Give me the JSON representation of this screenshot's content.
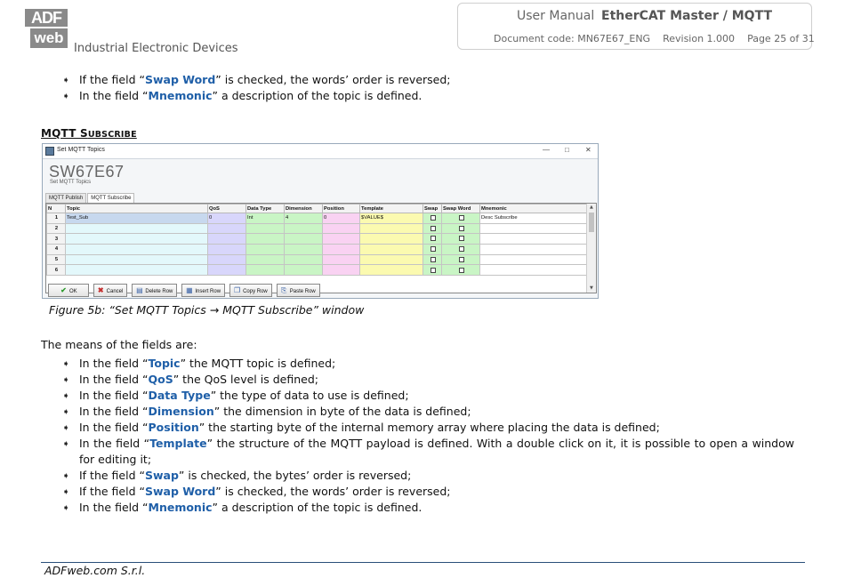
{
  "header": {
    "logo_top": "ADF",
    "logo_bottom": "web",
    "company": "Industrial Electronic Devices",
    "manual": "User Manual",
    "product": "EtherCAT Master / MQTT",
    "doc_code": "Document code: MN67E67_ENG",
    "revision": "Revision 1.000",
    "page": "Page 25 of 31"
  },
  "bullet_icon": "arrow-bullet-icon",
  "top_list": [
    {
      "pre": "If the field “",
      "term": "Swap Word",
      "post": "” is checked, the words’ order is reversed;"
    },
    {
      "pre": "In the field “",
      "term": "Mnemonic",
      "post": "” a description of the topic is defined."
    }
  ],
  "section_title": {
    "first": "MQTT S",
    "rest": "UBSCRIBE"
  },
  "window": {
    "title": "Set MQTT Topics",
    "controls": [
      "—",
      "□",
      "✕"
    ],
    "app_title": "SW67E67",
    "app_subtitle": "Set MQTT Topics",
    "tabs": [
      "MQTT Publish",
      "MQTT Subscribe"
    ],
    "active_tab": 1,
    "columns": [
      "N",
      "Topic",
      "QoS",
      "Data Type",
      "Dimension",
      "Position",
      "Template",
      "Swap",
      "Swap Word",
      "Mnemonic"
    ],
    "rows": [
      {
        "n": "1",
        "topic": "Test_Sub",
        "qos": "0",
        "data_type": "Int",
        "dimension": "4",
        "position": "0",
        "template": "$VALUE$",
        "swap": false,
        "swap_word": false,
        "mnemonic": "Desc Subscribe"
      },
      {
        "n": "2",
        "topic": "",
        "qos": "",
        "data_type": "",
        "dimension": "",
        "position": "",
        "template": "",
        "swap": false,
        "swap_word": false,
        "mnemonic": ""
      },
      {
        "n": "3",
        "topic": "",
        "qos": "",
        "data_type": "",
        "dimension": "",
        "position": "",
        "template": "",
        "swap": false,
        "swap_word": false,
        "mnemonic": ""
      },
      {
        "n": "4",
        "topic": "",
        "qos": "",
        "data_type": "",
        "dimension": "",
        "position": "",
        "template": "",
        "swap": false,
        "swap_word": false,
        "mnemonic": ""
      },
      {
        "n": "5",
        "topic": "",
        "qos": "",
        "data_type": "",
        "dimension": "",
        "position": "",
        "template": "",
        "swap": false,
        "swap_word": false,
        "mnemonic": ""
      },
      {
        "n": "6",
        "topic": "",
        "qos": "",
        "data_type": "",
        "dimension": "",
        "position": "",
        "template": "",
        "swap": false,
        "swap_word": false,
        "mnemonic": ""
      }
    ],
    "buttons": [
      {
        "label": "OK",
        "icon": "check-icon"
      },
      {
        "label": "Cancel",
        "icon": "cross-icon"
      },
      {
        "label": "Delete Row",
        "icon": "delete-row-icon"
      },
      {
        "label": "Insert Row",
        "icon": "insert-row-icon"
      },
      {
        "label": "Copy Row",
        "icon": "copy-row-icon"
      },
      {
        "label": "Paste Row",
        "icon": "paste-row-icon"
      }
    ]
  },
  "caption": "Figure 5b: “Set MQTT Topics → MQTT Subscribe” window",
  "means_intro": "The means of the fields are:",
  "fields_list": [
    {
      "pre": "In the field “",
      "term": "Topic",
      "post": "” the MQTT topic is defined;"
    },
    {
      "pre": "In the field “",
      "term": "QoS",
      "post": "” the QoS level is defined;"
    },
    {
      "pre": "In the field “",
      "term": "Data Type",
      "post": "” the type of data to use is defined;"
    },
    {
      "pre": "In the field “",
      "term": "Dimension",
      "post": "” the dimension in byte of the data is defined;"
    },
    {
      "pre": "In the field “",
      "term": "Position",
      "post": "” the starting byte of the internal memory array where placing the data is defined;"
    },
    {
      "pre": "In the field “",
      "term": "Template",
      "post": "” the structure of the MQTT payload is defined. With a double click on it, it is possible to open a window for editing it;"
    },
    {
      "pre": "If the field “",
      "term": "Swap",
      "post": "” is checked, the bytes’ order is reversed;"
    },
    {
      "pre": "If the field “",
      "term": "Swap Word",
      "post": "” is checked, the words’ order is reversed;"
    },
    {
      "pre": "In the field “",
      "term": "Mnemonic",
      "post": "” a description of the topic is defined."
    }
  ],
  "footer": "ADFweb.com S.r.l.",
  "colors": {
    "term": "#1f5fa8",
    "topic_col": "#e3f8fb",
    "qos_col": "#d8d6fb",
    "green_col": "#c9f5c5",
    "position_col": "#f9d2f2",
    "template_col": "#fbfab0",
    "footer_line": "#2a4f7a"
  }
}
